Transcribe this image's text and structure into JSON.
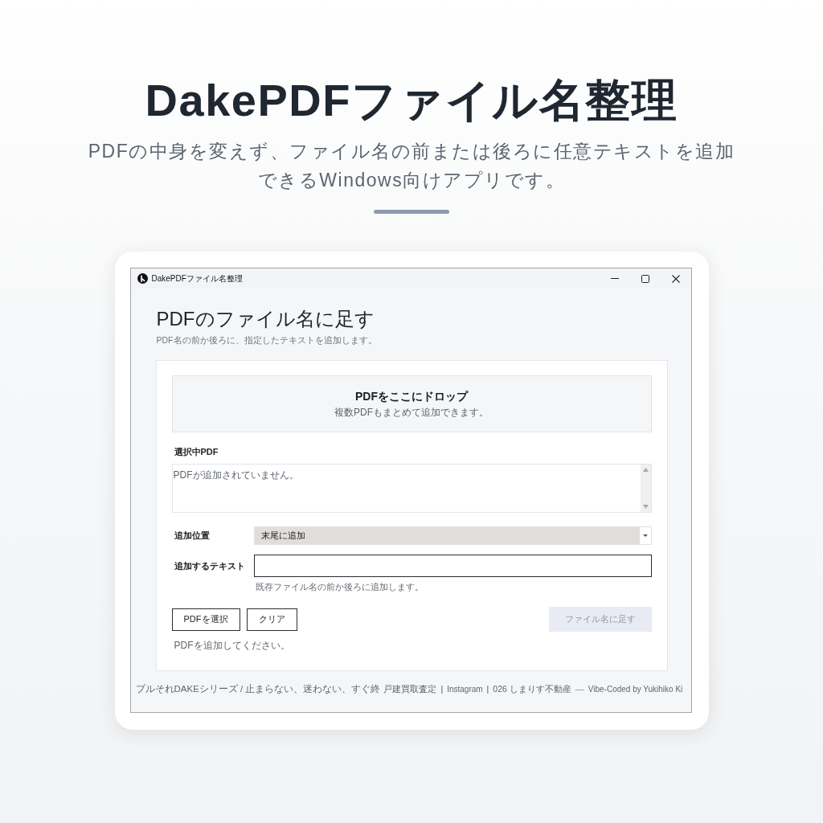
{
  "hero": {
    "title": "DakePDFファイル名整理",
    "subtitle": [
      "PDFの中身を変えず、ファイル名の前または後ろに任意テキストを追加",
      "できるWindows向けアプリです。"
    ]
  },
  "window": {
    "title": "DakePDFファイル名整理"
  },
  "app": {
    "heading": "PDFのファイル名に足す",
    "subheading": "PDF名の前か後ろに、指定したテキストを追加します。"
  },
  "drop_zone": {
    "title": "PDFをここにドロップ",
    "hint": "複数PDFもまとめて追加できます。"
  },
  "selected_pdfs": {
    "label": "選択中PDF",
    "empty_message": "PDFが追加されていません。"
  },
  "fields": [
    {
      "kind": "select",
      "label": "追加位置",
      "value": "末尾に追加"
    },
    {
      "kind": "text",
      "label": "追加するテキスト",
      "hint": "既存ファイル名の前か後ろに追加します。"
    }
  ],
  "buttons": [
    {
      "label": "PDFを選択",
      "kind": "secondary",
      "disabled": false
    },
    {
      "label": "クリア",
      "kind": "secondary",
      "disabled": false
    },
    {
      "label": "ファイル名に足す",
      "kind": "primary",
      "disabled": true
    }
  ],
  "status": "PDFを追加してください。",
  "footer": [
    {
      "kind": "text",
      "text": "プルそれDAKEシリーズ / 止まらない、迷わない、すぐ終"
    },
    {
      "kind": "link",
      "text": "戸建買取査定"
    },
    {
      "kind": "separator",
      "text": "|"
    },
    {
      "kind": "link",
      "text": "Instagram"
    },
    {
      "kind": "separator",
      "text": "|"
    },
    {
      "kind": "link",
      "text": "026 しまりす不動産"
    },
    {
      "kind": "dash",
      "text": "—"
    },
    {
      "kind": "text",
      "text": "Vibe-Coded by Yukihiko Ki"
    }
  ]
}
